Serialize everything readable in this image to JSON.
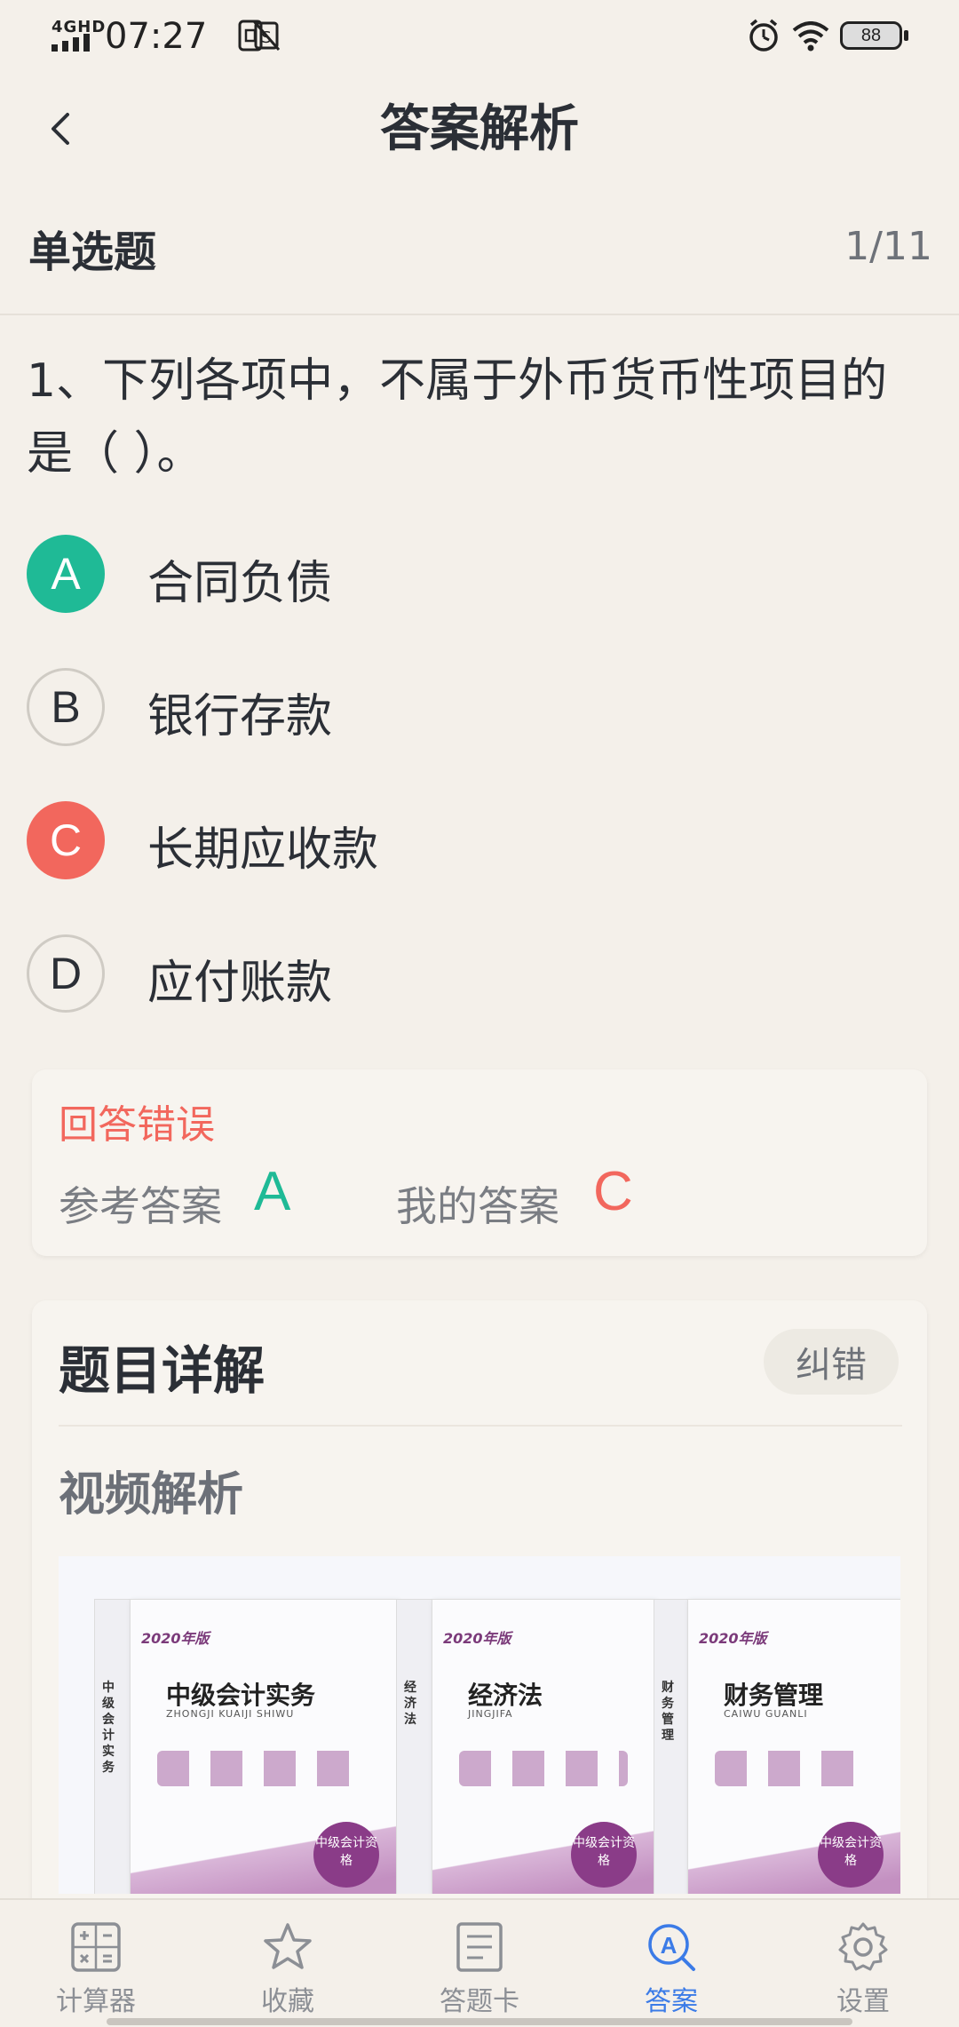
{
  "status_bar": {
    "network": "4GHD",
    "time": "07:27",
    "battery": "88"
  },
  "header": {
    "title": "答案解析"
  },
  "question_meta": {
    "type": "单选题",
    "progress": "1/11"
  },
  "question": {
    "text": "1、下列各项中，不属于外币货币性项目的是（ ）。"
  },
  "options": [
    {
      "letter": "A",
      "text": "合同负债",
      "state": "correct"
    },
    {
      "letter": "B",
      "text": "银行存款",
      "state": "normal"
    },
    {
      "letter": "C",
      "text": "长期应收款",
      "state": "wrong"
    },
    {
      "letter": "D",
      "text": "应付账款",
      "state": "normal"
    }
  ],
  "result": {
    "status": "回答错误",
    "reference_label": "参考答案",
    "reference_answer": "A",
    "my_label": "我的答案",
    "my_answer": "C"
  },
  "detail": {
    "title": "题目详解",
    "report_button": "纠错",
    "video_title": "视频解析"
  },
  "video_books": [
    {
      "year": "2020年版",
      "title": "中级会计实务",
      "pinyin": "ZHONGJI KUAIJI SHIWU",
      "spine": "中级会计实务",
      "seal": "中级会计资格"
    },
    {
      "year": "2020年版",
      "title": "经济法",
      "pinyin": "JINGJIFA",
      "spine": "经济法",
      "seal": "中级会计资格"
    },
    {
      "year": "2020年版",
      "title": "财务管理",
      "pinyin": "CAIWU GUANLI",
      "spine": "财务管理",
      "seal": "中级会计资格"
    }
  ],
  "tabbar": [
    {
      "label": "计算器",
      "icon": "calculator-icon",
      "active": false
    },
    {
      "label": "收藏",
      "icon": "star-icon",
      "active": false
    },
    {
      "label": "答题卡",
      "icon": "answer-card-icon",
      "active": false
    },
    {
      "label": "答案",
      "icon": "answer-search-icon",
      "active": true
    },
    {
      "label": "设置",
      "icon": "gear-icon",
      "active": false
    }
  ],
  "colors": {
    "correct": "#1fba96",
    "wrong": "#f2675d",
    "active_tab": "#3b7be7",
    "background": "#f4f0ea"
  }
}
